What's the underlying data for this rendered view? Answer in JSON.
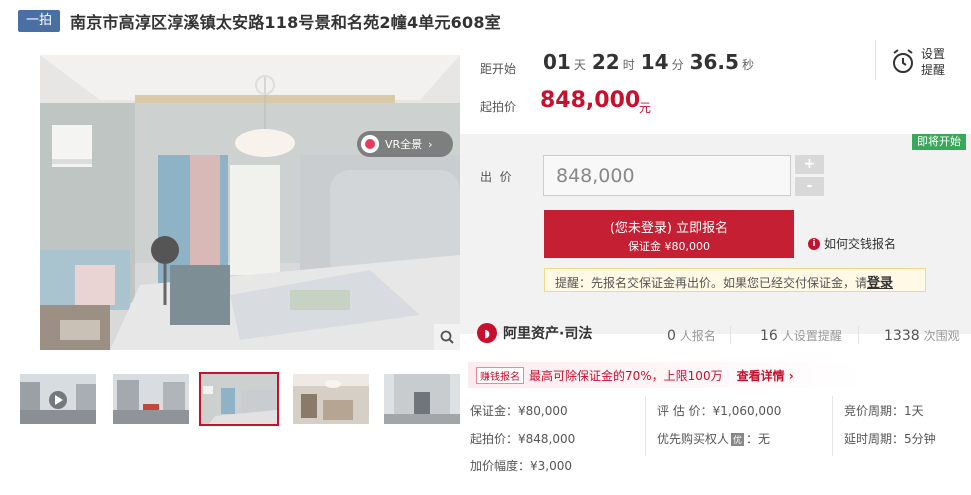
{
  "header": {
    "tag": "一拍",
    "title": "南京市高淳区淳溪镇太安路118号景和名苑2幢4单元608室"
  },
  "gallery": {
    "vr_label": "VR全景",
    "vr_arrow": "›",
    "thumbnails": [
      "exterior-street-video",
      "exterior-street",
      "bedroom",
      "living-room",
      "building-gate"
    ]
  },
  "countdown": {
    "label": "距开始",
    "days": "01",
    "days_unit": "天",
    "hours": "22",
    "hours_unit": "时",
    "minutes": "14",
    "minutes_unit": "分",
    "seconds": "36.5",
    "seconds_unit": "秒"
  },
  "reminder": {
    "label_line1": "设置",
    "label_line2": "提醒"
  },
  "start_price": {
    "label": "起拍价",
    "value": "848,000",
    "unit": "元"
  },
  "bid": {
    "status_tag": "即将开始",
    "label": "出  价",
    "input_value": "848,000",
    "plus": "+",
    "minus": "-",
    "apply_line1": "(您未登录) 立即报名",
    "apply_line2": "保证金 ¥80,000",
    "howto": "如何交钱报名",
    "notice_text": "提醒：先报名交保证金再出价。如果您已经交付保证金，请",
    "notice_link": "登录"
  },
  "brand": {
    "name": "阿里资产·司法"
  },
  "stats": [
    {
      "count": "0",
      "label": "人报名"
    },
    {
      "count": "16",
      "label": "人设置提醒"
    },
    {
      "count": "1338",
      "label": "次围观"
    }
  ],
  "promo": {
    "tag": "赚钱报名",
    "text": "最高可除保证金的70%，上限100万",
    "link": "查看详情",
    "link_arrow": "›"
  },
  "info": {
    "deposit": "保证金：¥80,000",
    "appraisal": "评 估 价：¥1,060,000",
    "period": "竞价周期：1天",
    "start_price": "起拍价：¥848,000",
    "priority_label": "优先购买权人",
    "priority_badge": "优",
    "priority_value": "：无",
    "delay": "延时周期：5分钟",
    "increment": "加价幅度：¥3,000"
  },
  "colors": {
    "accent": "#c8102e",
    "tag": "#4a6fa5",
    "soon": "#3aa85a"
  },
  "icons": [
    "alarm-clock-icon",
    "zoom-icon",
    "play-icon",
    "info-icon",
    "chevron-right-icon"
  ]
}
